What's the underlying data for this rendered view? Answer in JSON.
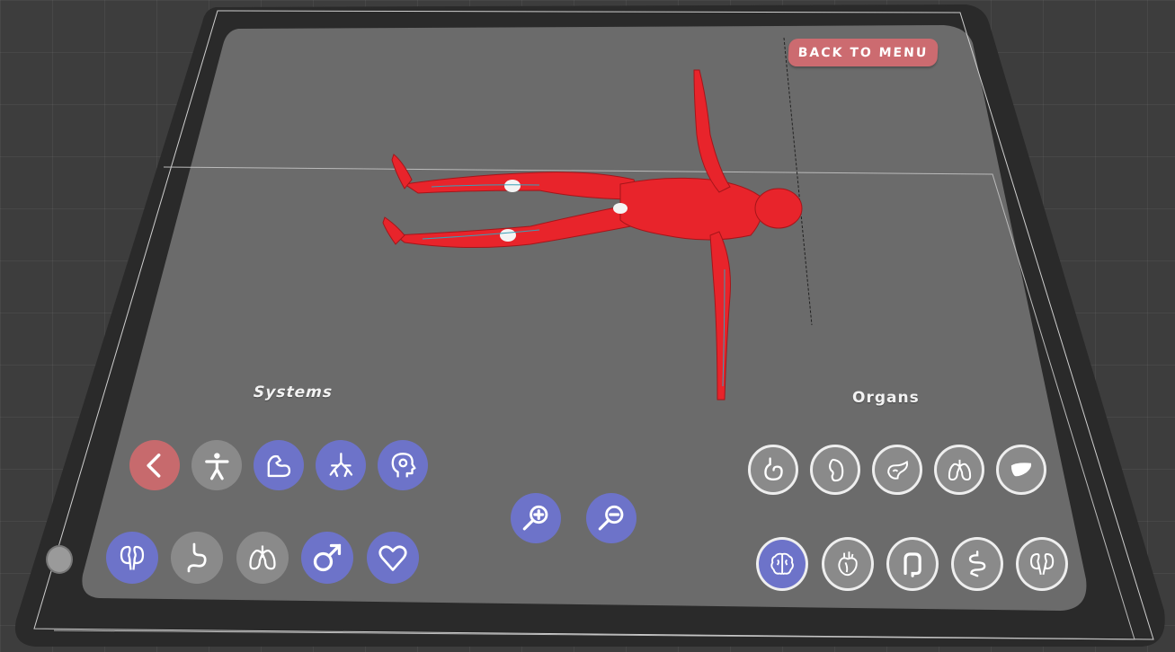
{
  "app": {
    "back_button_label": "BACK TO MENU",
    "systems_label": "Systems",
    "organs_label": "Organs"
  },
  "colors": {
    "background": "#3d3d3d",
    "panel": "#6b6b6b",
    "accent_blue": "#6d73c9",
    "accent_red": "#c76a6d",
    "button_grey": "#8a8a8a",
    "muscle_red": "#e8242b"
  },
  "systems": {
    "row1": [
      {
        "icon": "chevron-left-icon",
        "state": "back"
      },
      {
        "icon": "skeleton-body-icon",
        "state": "inactive"
      },
      {
        "icon": "muscle-arm-icon",
        "state": "active"
      },
      {
        "icon": "lungs-bronchi-icon",
        "state": "active"
      },
      {
        "icon": "head-brain-gear-icon",
        "state": "active"
      }
    ],
    "row2": [
      {
        "icon": "kidneys-icon",
        "state": "active"
      },
      {
        "icon": "digestive-tract-icon",
        "state": "inactive"
      },
      {
        "icon": "lungs-icon",
        "state": "inactive"
      },
      {
        "icon": "male-symbol-icon",
        "state": "active"
      },
      {
        "icon": "heart-icon",
        "state": "active"
      }
    ]
  },
  "zoom": [
    {
      "icon": "zoom-in-icon"
    },
    {
      "icon": "zoom-out-icon"
    }
  ],
  "organs": {
    "row1": [
      {
        "icon": "stomach-icon",
        "state": "inactive"
      },
      {
        "icon": "spleen-icon",
        "state": "inactive"
      },
      {
        "icon": "pancreas-icon",
        "state": "inactive"
      },
      {
        "icon": "lungs-icon",
        "state": "inactive"
      },
      {
        "icon": "liver-icon",
        "state": "inactive"
      }
    ],
    "row2": [
      {
        "icon": "brain-icon",
        "state": "active"
      },
      {
        "icon": "heart-anatomical-icon",
        "state": "inactive"
      },
      {
        "icon": "large-intestine-icon",
        "state": "inactive"
      },
      {
        "icon": "small-intestine-icon",
        "state": "inactive"
      },
      {
        "icon": "kidneys-icon",
        "state": "inactive"
      }
    ]
  }
}
